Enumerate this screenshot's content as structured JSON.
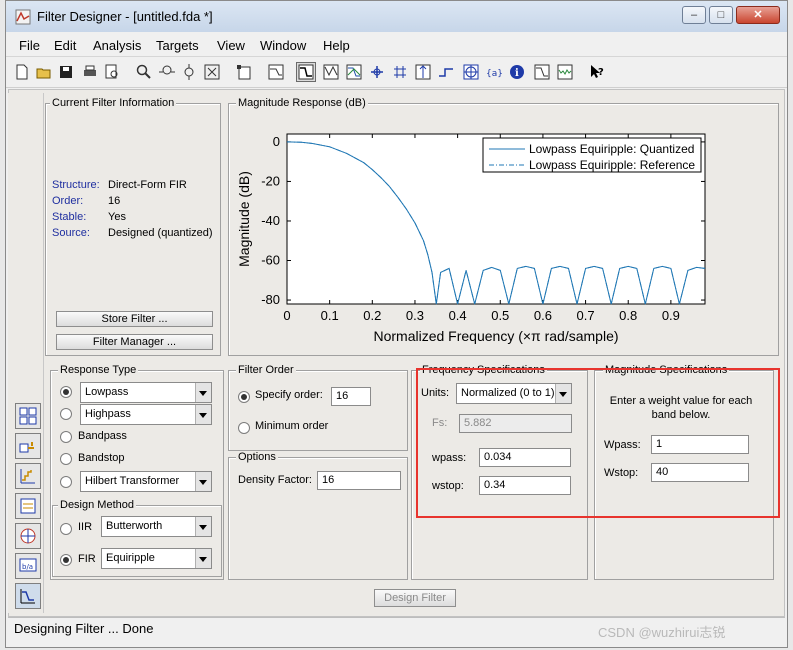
{
  "window": {
    "title": "Filter Designer -  [untitled.fda *]",
    "minimize": "–",
    "maximize": "□",
    "close": "✕"
  },
  "menu": [
    "File",
    "Edit",
    "Analysis",
    "Targets",
    "View",
    "Window",
    "Help"
  ],
  "toolbar_icons": [
    "new-icon",
    "open-icon",
    "save-icon",
    "print-icon",
    "print-preview-icon",
    "zoom-in-icon",
    "zoom-x-icon",
    "zoom-y-icon",
    "full-view-icon",
    "new-figure-icon",
    "filter-specs-icon",
    "magnitude-response-icon",
    "phase-response-icon",
    "mag-phase-icon",
    "group-delay-icon",
    "phase-delay-icon",
    "impulse-response-icon",
    "step-response-icon",
    "pole-zero-icon",
    "coefficients-icon",
    "filter-info-icon",
    "magnitude-estimate-icon",
    "noise-power-icon",
    "whats-this-icon"
  ],
  "current_filter": {
    "title": "Current Filter Information",
    "rows": [
      {
        "label": "Structure:",
        "value": "Direct-Form FIR"
      },
      {
        "label": "Order:",
        "value": "16"
      },
      {
        "label": "Stable:",
        "value": "Yes"
      },
      {
        "label": "Source:",
        "value": "Designed (quantized)"
      }
    ],
    "store_button": "Store Filter ...",
    "manager_button": "Filter Manager ..."
  },
  "magnitude_panel": {
    "title": "Magnitude Response (dB)"
  },
  "chart_data": {
    "type": "line",
    "xlabel": "Normalized Frequency (×π rad/sample)",
    "ylabel": "Magnitude (dB)",
    "xlim": [
      0,
      0.98
    ],
    "ylim": [
      -82,
      4
    ],
    "xticks": [
      "0",
      "0.1",
      "0.2",
      "0.3",
      "0.4",
      "0.5",
      "0.6",
      "0.7",
      "0.8",
      "0.9"
    ],
    "yticks": [
      "0",
      "-20",
      "-40",
      "-60",
      "-80"
    ],
    "grid": false,
    "legend_position": "top-right",
    "series": [
      {
        "name": "Lowpass Equiripple: Quantized",
        "style": "solid",
        "color": "#1f77b4",
        "x": [
          0,
          0.034,
          0.06,
          0.1,
          0.14,
          0.18,
          0.2,
          0.22,
          0.24,
          0.26,
          0.28,
          0.3,
          0.32,
          0.33,
          0.34,
          0.35,
          0.36,
          0.38,
          0.4,
          0.42,
          0.44,
          0.46,
          0.48,
          0.5,
          0.52,
          0.54,
          0.56,
          0.58,
          0.6,
          0.62,
          0.64,
          0.66,
          0.68,
          0.7,
          0.72,
          0.74,
          0.76,
          0.78,
          0.8,
          0.82,
          0.84,
          0.86,
          0.88,
          0.9,
          0.92,
          0.94,
          0.96,
          0.98
        ],
        "y": [
          0,
          -0.2,
          -0.8,
          -2.5,
          -5.8,
          -10.5,
          -14,
          -18,
          -22.5,
          -28,
          -34,
          -41,
          -50,
          -57,
          -66,
          -82,
          -66,
          -64,
          -82,
          -65,
          -82,
          -65,
          -63.5,
          -65,
          -82,
          -64,
          -63,
          -64,
          -82,
          -64,
          -63,
          -64,
          -82,
          -64,
          -63,
          -64,
          -82,
          -64,
          -63,
          -64,
          -82,
          -64,
          -63,
          -64,
          -82,
          -65,
          -63.5,
          -64
        ]
      },
      {
        "name": "Lowpass Equiripple: Reference",
        "style": "dash-dot",
        "color": "#1f77b4",
        "x": [
          0,
          0.034,
          0.06,
          0.1,
          0.14,
          0.18,
          0.2,
          0.22,
          0.24,
          0.26,
          0.28,
          0.3,
          0.32,
          0.33,
          0.34,
          0.35,
          0.36,
          0.38,
          0.4,
          0.42,
          0.44,
          0.46,
          0.48,
          0.5,
          0.52,
          0.54,
          0.56,
          0.58,
          0.6,
          0.62,
          0.64,
          0.66,
          0.68,
          0.7,
          0.72,
          0.74,
          0.76,
          0.78,
          0.8,
          0.82,
          0.84,
          0.86,
          0.88,
          0.9,
          0.92,
          0.94,
          0.96,
          0.98
        ],
        "y": [
          0,
          -0.2,
          -0.8,
          -2.5,
          -5.8,
          -10.5,
          -14,
          -18,
          -22.5,
          -28,
          -34,
          -41,
          -50,
          -57,
          -66,
          -82,
          -66,
          -64,
          -82,
          -65,
          -82,
          -65,
          -63.5,
          -65,
          -82,
          -64,
          -63,
          -64,
          -82,
          -64,
          -63,
          -64,
          -82,
          -64,
          -63,
          -64,
          -82,
          -64,
          -63,
          -64,
          -82,
          -64,
          -63,
          -64,
          -82,
          -65,
          -63.5,
          -64
        ]
      }
    ]
  },
  "response_type": {
    "title": "Response Type",
    "options": [
      {
        "label": "Lowpass",
        "selected": true,
        "dropdown": true
      },
      {
        "label": "Highpass",
        "selected": false,
        "dropdown": true
      },
      {
        "label": "Bandpass",
        "selected": false,
        "dropdown": false
      },
      {
        "label": "Bandstop",
        "selected": false,
        "dropdown": false
      },
      {
        "label": "Hilbert Transformer",
        "selected": false,
        "dropdown": true
      }
    ]
  },
  "design_method": {
    "title": "Design Method",
    "iir_label": "IIR",
    "iir_value": "Butterworth",
    "fir_label": "FIR",
    "fir_value": "Equiripple",
    "selected": "FIR"
  },
  "filter_order": {
    "title": "Filter Order",
    "specify_label": "Specify order:",
    "specify_value": "16",
    "minimum_label": "Minimum order",
    "selected": "specify"
  },
  "options": {
    "title": "Options",
    "density_label": "Density Factor:",
    "density_value": "16"
  },
  "frequency_specs": {
    "title": "Frequency Specifications",
    "units_label": "Units:",
    "units_value": "Normalized (0 to 1)",
    "fs_label": "Fs:",
    "fs_value": "5.882",
    "wpass_label": "wpass:",
    "wpass_value": "0.034",
    "wstop_label": "wstop:",
    "wstop_value": "0.34"
  },
  "magnitude_specs": {
    "title": "Magnitude Specifications",
    "note": "Enter a weight value for each band below.",
    "wpass_label": "Wpass:",
    "wpass_value": "1",
    "wstop_label": "Wstop:",
    "wstop_value": "40"
  },
  "design_button": "Design Filter",
  "status": "Designing Filter ... Done",
  "watermark": "CSDN @wuzhirui志锐",
  "colors": {
    "accent_blue": "#1f2fa0",
    "plot_line": "#1f77b4",
    "highlight_red": "#e8342e"
  }
}
